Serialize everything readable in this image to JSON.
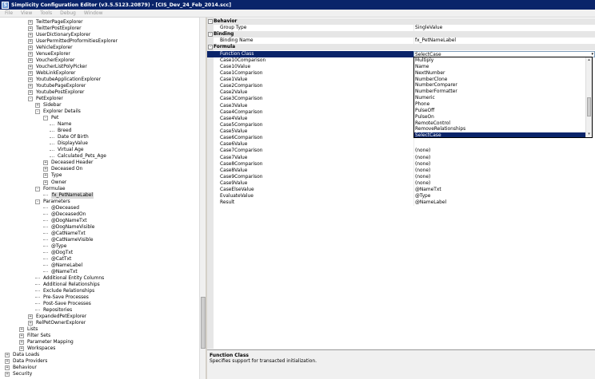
{
  "window": {
    "title": "Simplicity Configuration Editor (v3.5.5123.20879) - [CIS_Dev_24_Feb_2014.scc]"
  },
  "menu": [
    "File",
    "View",
    "Tools",
    "Debug",
    "Window"
  ],
  "tree": [
    {
      "label": "TwitterPageExplorer",
      "indent": 0,
      "state": "+"
    },
    {
      "label": "TwitterPostExplorer",
      "indent": 0,
      "state": "+"
    },
    {
      "label": "UserDictionaryExplorer",
      "indent": 0,
      "state": "+"
    },
    {
      "label": "UserPermittedProformitiesExplorer",
      "indent": 0,
      "state": "+"
    },
    {
      "label": "VehicleExplorer",
      "indent": 0,
      "state": "+"
    },
    {
      "label": "VenueExplorer",
      "indent": 0,
      "state": "+"
    },
    {
      "label": "VoucherExplorer",
      "indent": 0,
      "state": "+"
    },
    {
      "label": "VoucherListPolyPicker",
      "indent": 0,
      "state": "+"
    },
    {
      "label": "WebLinkExplorer",
      "indent": 0,
      "state": "+"
    },
    {
      "label": "YoutubeApplicationExplorer",
      "indent": 0,
      "state": "+"
    },
    {
      "label": "YoutubePageExplorer",
      "indent": 0,
      "state": "+"
    },
    {
      "label": "YoutubePostExplorer",
      "indent": 0,
      "state": "+"
    },
    {
      "label": "PetExplorer",
      "indent": 0,
      "state": "-"
    },
    {
      "label": "Sidebar",
      "indent": 1,
      "state": "+"
    },
    {
      "label": "Explorer Details",
      "indent": 1,
      "state": "-"
    },
    {
      "label": "Pet",
      "indent": 2,
      "state": "-"
    },
    {
      "label": "Name",
      "indent": 3,
      "state": ""
    },
    {
      "label": "Breed",
      "indent": 3,
      "state": ""
    },
    {
      "label": "Date Of Birth",
      "indent": 3,
      "state": ""
    },
    {
      "label": "DisplayValue",
      "indent": 3,
      "state": ""
    },
    {
      "label": "Virtual Age",
      "indent": 3,
      "state": ""
    },
    {
      "label": "Calculated_Pets_Age",
      "indent": 3,
      "state": ""
    },
    {
      "label": "Deceased Header",
      "indent": 2,
      "state": "+"
    },
    {
      "label": "Deceased On",
      "indent": 2,
      "state": "+"
    },
    {
      "label": "Type",
      "indent": 2,
      "state": "+"
    },
    {
      "label": "Owner",
      "indent": 2,
      "state": "+"
    },
    {
      "label": "Formulae",
      "indent": 1,
      "state": "-"
    },
    {
      "label": "fx_PetNameLabel",
      "indent": 2,
      "state": "",
      "selected": true
    },
    {
      "label": "Parameters",
      "indent": 1,
      "state": "-"
    },
    {
      "label": "@Deceased",
      "indent": 2,
      "state": ""
    },
    {
      "label": "@DeceasedOn",
      "indent": 2,
      "state": ""
    },
    {
      "label": "@DogNameTxt",
      "indent": 2,
      "state": ""
    },
    {
      "label": "@DogNameVisible",
      "indent": 2,
      "state": ""
    },
    {
      "label": "@CatNameTxt",
      "indent": 2,
      "state": ""
    },
    {
      "label": "@CatNameVisible",
      "indent": 2,
      "state": ""
    },
    {
      "label": "@Type",
      "indent": 2,
      "state": ""
    },
    {
      "label": "@DogTxt",
      "indent": 2,
      "state": ""
    },
    {
      "label": "@CatTxt",
      "indent": 2,
      "state": ""
    },
    {
      "label": "@NameLabel",
      "indent": 2,
      "state": ""
    },
    {
      "label": "@NameTxt",
      "indent": 2,
      "state": ""
    },
    {
      "label": "Additional Entity Columns",
      "indent": 1,
      "state": ""
    },
    {
      "label": "Additional Relationships",
      "indent": 1,
      "state": ""
    },
    {
      "label": "Exclude Relationships",
      "indent": 1,
      "state": ""
    },
    {
      "label": "Pre-Save Processes",
      "indent": 1,
      "state": ""
    },
    {
      "label": "Post-Save Processes",
      "indent": 1,
      "state": ""
    },
    {
      "label": "Repositories",
      "indent": 1,
      "state": ""
    },
    {
      "label": "ExpandedPetExplorer",
      "indent": 0,
      "state": "+"
    },
    {
      "label": "RelPetOwnerExplorer",
      "indent": 0,
      "state": "+"
    },
    {
      "label": "Lists",
      "indent": -1,
      "state": "+"
    },
    {
      "label": "Filter Sets",
      "indent": -1,
      "state": "+"
    },
    {
      "label": "Parameter Mapping",
      "indent": -1,
      "state": "+"
    },
    {
      "label": "Workspaces",
      "indent": -1,
      "state": "+"
    },
    {
      "label": "Data Loads",
      "indent": -2,
      "state": "+"
    },
    {
      "label": "Data Providers",
      "indent": -2,
      "state": "+"
    },
    {
      "label": "Behaviour",
      "indent": -2,
      "state": "+"
    },
    {
      "label": "Security",
      "indent": -2,
      "state": "+"
    }
  ],
  "grid": [
    {
      "kind": "section",
      "name": "Behavior"
    },
    {
      "name": "Group Type",
      "value": "SingleValue"
    },
    {
      "kind": "section",
      "name": "Binding"
    },
    {
      "name": "Binding Name",
      "value": "fx_PetNameLabel"
    },
    {
      "kind": "section",
      "name": "Formula"
    },
    {
      "name": "Function Class",
      "value": "SelectCase",
      "selected": true
    },
    {
      "name": "Case10Comparison",
      "value": ""
    },
    {
      "name": "Case10Value",
      "value": ""
    },
    {
      "name": "Case1Comparison",
      "value": ""
    },
    {
      "name": "Case1Value",
      "value": ""
    },
    {
      "name": "Case2Comparison",
      "value": ""
    },
    {
      "name": "Case2Value",
      "value": ""
    },
    {
      "name": "Case3Comparison",
      "value": ""
    },
    {
      "name": "Case3Value",
      "value": ""
    },
    {
      "name": "Case4Comparison",
      "value": ""
    },
    {
      "name": "Case4Value",
      "value": ""
    },
    {
      "name": "Case5Comparison",
      "value": ""
    },
    {
      "name": "Case5Value",
      "value": ""
    },
    {
      "name": "Case6Comparison",
      "value": ""
    },
    {
      "name": "Case6Value",
      "value": ""
    },
    {
      "name": "Case7Comparison",
      "value": "(none)"
    },
    {
      "name": "Case7Value",
      "value": "(none)"
    },
    {
      "name": "Case8Comparison",
      "value": "(none)"
    },
    {
      "name": "Case8Value",
      "value": "(none)"
    },
    {
      "name": "Case9Comparison",
      "value": "(none)"
    },
    {
      "name": "Case9Value",
      "value": "(none)"
    },
    {
      "name": "CaseElseValue",
      "value": "@NameTxt"
    },
    {
      "name": "EvaluateValue",
      "value": "@Type"
    },
    {
      "name": "Result",
      "value": "@NameLabel"
    }
  ],
  "dropdown": {
    "items": [
      "Multiply",
      "Name",
      "NextNumber",
      "NumberClone",
      "NumberComparer",
      "NumberFormatter",
      "Numeric",
      "Phone",
      "PulseOff",
      "PulseOn",
      "RemoteControl",
      "RemoveRelationships",
      "SelectCase"
    ],
    "selected": "SelectCase"
  },
  "description": {
    "title": "Function Class",
    "text": "Specifies support for transacted initialization."
  },
  "icons": {
    "app": "S",
    "expand": "+",
    "collapse": "-",
    "dropdown_arrow": "▾",
    "scroll_up": "▴",
    "scroll_down": "▾"
  }
}
